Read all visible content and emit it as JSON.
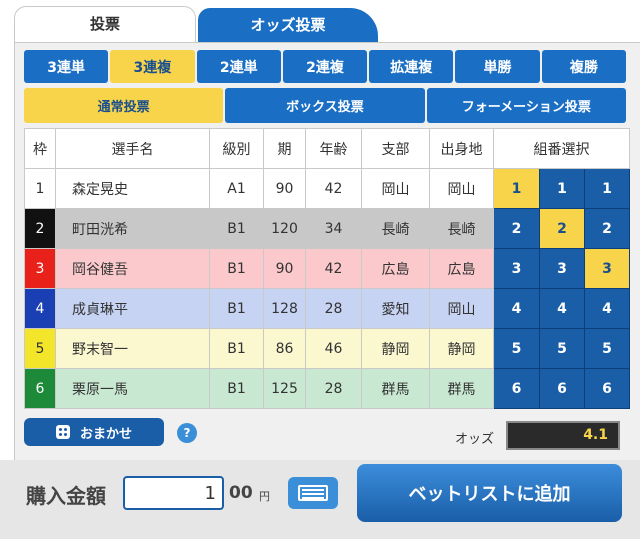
{
  "top_tabs": [
    {
      "label": "投票",
      "active": true
    },
    {
      "label": "オッズ投票",
      "active": false
    }
  ],
  "bet_types": [
    {
      "label": "3連単",
      "selected": false
    },
    {
      "label": "3連複",
      "selected": true
    },
    {
      "label": "2連単",
      "selected": false
    },
    {
      "label": "2連複",
      "selected": false
    },
    {
      "label": "拡連複",
      "selected": false
    },
    {
      "label": "単勝",
      "selected": false
    },
    {
      "label": "複勝",
      "selected": false
    }
  ],
  "modes": [
    {
      "label": "通常投票",
      "selected": true
    },
    {
      "label": "ボックス投票",
      "selected": false
    },
    {
      "label": "フォーメーション投票",
      "selected": false
    }
  ],
  "table": {
    "headers": [
      "枠",
      "選手名",
      "級別",
      "期",
      "年齢",
      "支部",
      "出身地",
      "組番選択"
    ],
    "rows": [
      {
        "waku": "1",
        "name": "森定晃史",
        "class": "A1",
        "term": "90",
        "age": "42",
        "branch": "岡山",
        "birthplace": "岡山",
        "picks": [
          "1",
          "1",
          "1"
        ],
        "on": [
          true,
          false,
          false
        ],
        "waku_color": "#ffffff",
        "waku_text": "#333333",
        "bg": "#ffffff"
      },
      {
        "waku": "2",
        "name": "町田洸希",
        "class": "B1",
        "term": "120",
        "age": "34",
        "branch": "長崎",
        "birthplace": "長崎",
        "picks": [
          "2",
          "2",
          "2"
        ],
        "on": [
          false,
          true,
          false
        ],
        "waku_color": "#111111",
        "waku_text": "#ffffff",
        "bg": "#c8c8c8"
      },
      {
        "waku": "3",
        "name": "岡谷健吾",
        "class": "B1",
        "term": "90",
        "age": "42",
        "branch": "広島",
        "birthplace": "広島",
        "picks": [
          "3",
          "3",
          "3"
        ],
        "on": [
          false,
          false,
          true
        ],
        "waku_color": "#e8211a",
        "waku_text": "#ffffff",
        "bg": "#fbc9cc"
      },
      {
        "waku": "4",
        "name": "成貞琳平",
        "class": "B1",
        "term": "128",
        "age": "28",
        "branch": "愛知",
        "birthplace": "岡山",
        "picks": [
          "4",
          "4",
          "4"
        ],
        "on": [
          false,
          false,
          false
        ],
        "waku_color": "#1a3fb5",
        "waku_text": "#ffffff",
        "bg": "#c7d3f3"
      },
      {
        "waku": "5",
        "name": "野末智一",
        "class": "B1",
        "term": "86",
        "age": "46",
        "branch": "静岡",
        "birthplace": "静岡",
        "picks": [
          "5",
          "5",
          "5"
        ],
        "on": [
          false,
          false,
          false
        ],
        "waku_color": "#f2e52a",
        "waku_text": "#333333",
        "bg": "#fbf8d0"
      },
      {
        "waku": "6",
        "name": "栗原一馬",
        "class": "B1",
        "term": "125",
        "age": "28",
        "branch": "群馬",
        "birthplace": "群馬",
        "picks": [
          "6",
          "6",
          "6"
        ],
        "on": [
          false,
          false,
          false
        ],
        "waku_color": "#1d8a3a",
        "waku_text": "#ffffff",
        "bg": "#c9e8d2"
      }
    ]
  },
  "omakase_label": "おまかせ",
  "help_label": "?",
  "odds_label": "オッズ",
  "odds_value": "4.1",
  "buy_label": "購入金額",
  "amount_value": "1",
  "amount_suffix": "00",
  "currency": "円",
  "add_betlist_label": "ベットリストに追加",
  "icons": {
    "omakase": "dice-icon",
    "help": "question-icon",
    "keyboard": "keyboard-icon"
  }
}
